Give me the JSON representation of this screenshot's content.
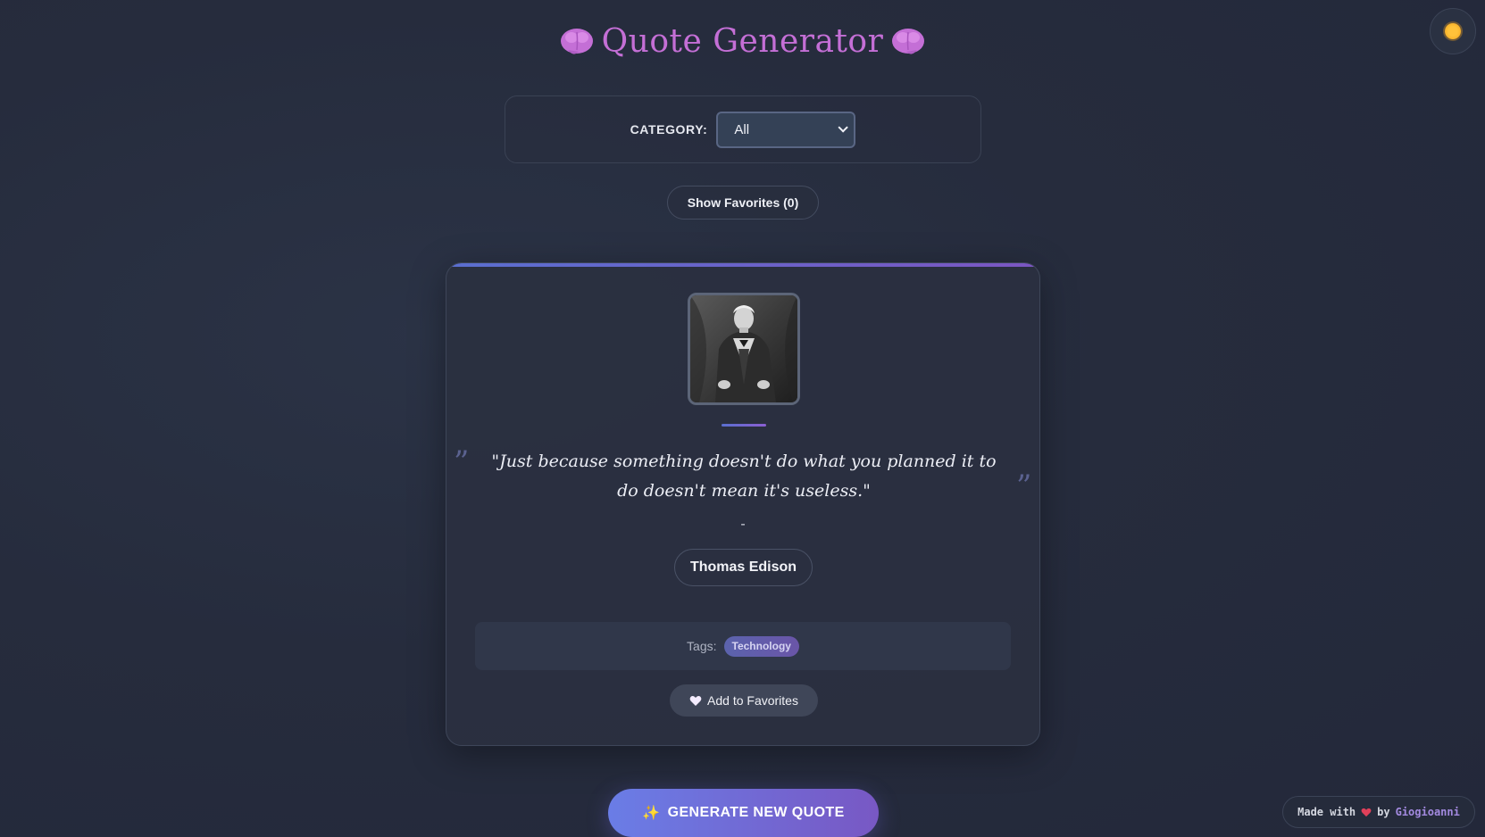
{
  "header": {
    "title": "Quote Generator",
    "left_icon": "brain-icon",
    "right_icon": "brain-icon",
    "title_color": "#c46fd6"
  },
  "theme_toggle": {
    "icon": "sun-icon"
  },
  "category": {
    "label": "CATEGORY:",
    "selected": "All"
  },
  "favorites_toggle": {
    "label": "Show Favorites (0)"
  },
  "quote": {
    "text": "\"Just because something doesn't do what you planned it to do doesn't mean it's useless.\"",
    "dash": "-",
    "author": "Thomas Edison",
    "tags_label": "Tags:",
    "tags": [
      "Technology"
    ],
    "add_favorites_label": "Add to Favorites",
    "open_mark": "”",
    "close_mark": "”"
  },
  "actions": {
    "generate_label": "GENERATE NEW QUOTE",
    "generate_icon": "✨"
  },
  "footer": {
    "made_with": "Made with",
    "by": "by",
    "author": "Giogioanni"
  },
  "colors": {
    "accent_start": "#6a7de6",
    "accent_end": "#7858c4",
    "background": "#262c3d",
    "heart": "#e0405a"
  }
}
